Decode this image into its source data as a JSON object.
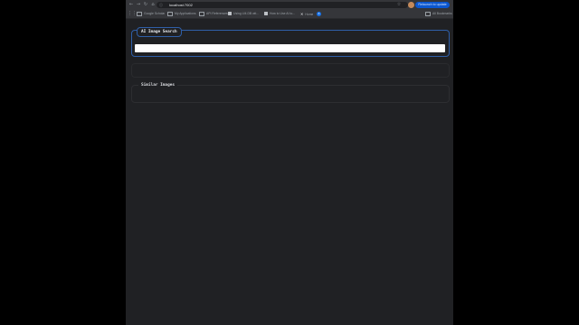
{
  "browser": {
    "url": "localhost:7002",
    "update_button": "Relaunch to update",
    "bookmarks": [
      {
        "label": "Google Scholar",
        "icon": "folder-icon"
      },
      {
        "label": "My Applications",
        "icon": "folder-icon"
      },
      {
        "label": "API References",
        "icon": "folder-icon"
      },
      {
        "label": "Using LM-DB wit...",
        "icon": "page-icon"
      },
      {
        "label": "How to Use AI to...",
        "icon": "page-icon"
      },
      {
        "label": "Home",
        "icon": "x-icon"
      }
    ],
    "bookmark_badge": "3",
    "all_bookmarks": "All Bookmarks"
  },
  "search": {
    "title": "AI Image Search",
    "input_value": ""
  },
  "similar": {
    "title": "Similar Images"
  }
}
